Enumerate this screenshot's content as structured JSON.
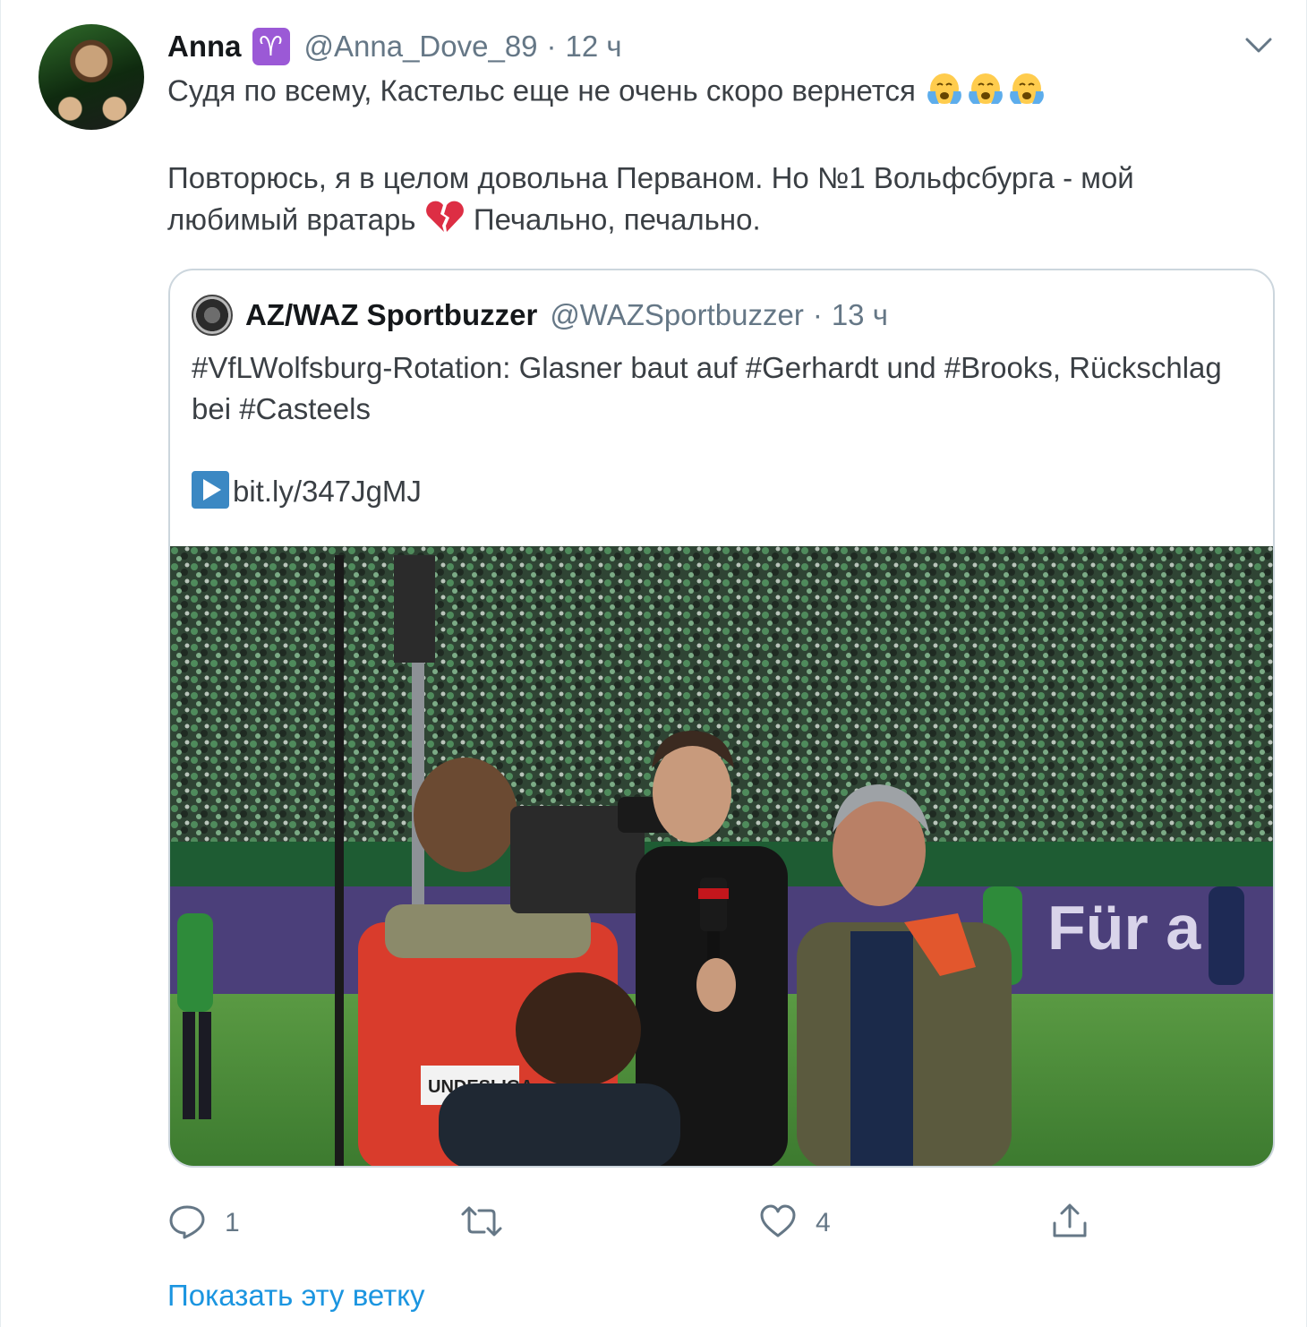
{
  "tweet": {
    "author": {
      "display_name": "Anna",
      "badge_icon": "aries-icon",
      "badge_glyph": "♈",
      "handle": "@Anna_Dove_89",
      "separator": "·",
      "time": "12 ч"
    },
    "text": {
      "line1": "Судя по всему, Кастельс еще не очень скоро вернется",
      "line1_emojis": [
        "crying-face-icon",
        "crying-face-icon",
        "crying-face-icon"
      ],
      "para2_a": "Повторюсь, я в целом довольна Перваном. Но №1 Вольфсбурга - мой любимый вратарь",
      "para2_emoji": "broken-heart-icon",
      "para2_b": "Печально, печально."
    },
    "quoted": {
      "display_name": "AZ/WAZ Sportbuzzer",
      "handle": "@WAZSportbuzzer",
      "separator": "·",
      "time": "13 ч",
      "text": "#VfLWolfsburg-Rotation: Glasner baut auf #Gerhardt und #Brooks, Rückschlag bei #Casteels",
      "link_icon": "play-button-icon",
      "link": "bit.ly/347JgMJ",
      "image": {
        "description_icon": "stadium-interview-photo",
        "pitch_banner_text": "Für a",
        "vest_text": "UNDESLIGA"
      }
    },
    "actions": {
      "reply_count": "1",
      "retweet_count": "",
      "like_count": "4"
    },
    "show_thread": "Показать эту ветку"
  },
  "colors": {
    "link_blue": "#1b95e0",
    "secondary_text": "#657786",
    "aries_purple": "#9b59d6",
    "border": "#ccd6dd"
  }
}
